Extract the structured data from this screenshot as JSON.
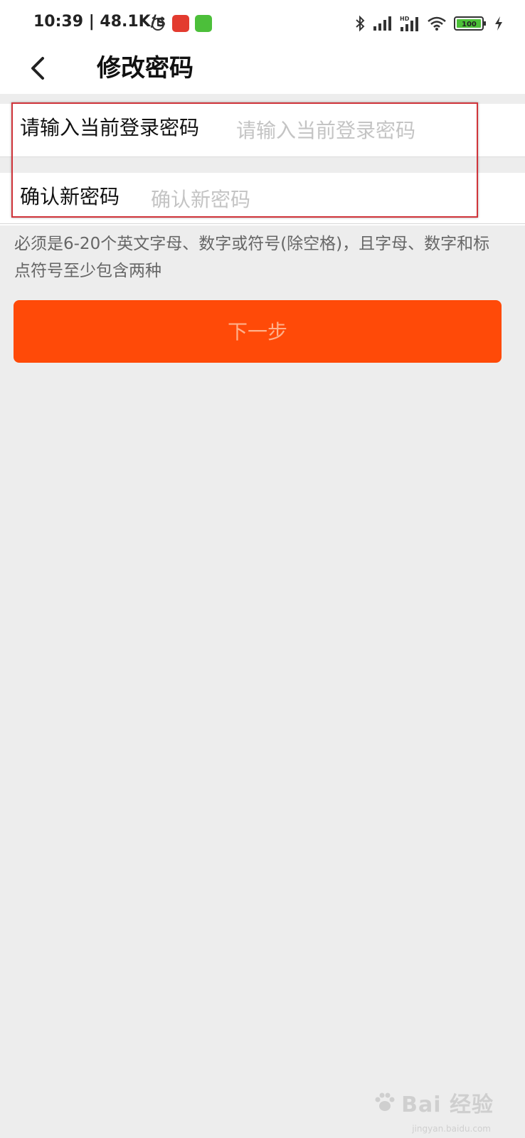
{
  "status_bar": {
    "time_speed": "10:39 | 48.1K/s",
    "battery": "100",
    "network_hd": "HD"
  },
  "nav": {
    "title": "修改密码"
  },
  "form": {
    "current_password_label": "请输入当前登录密码",
    "current_password_placeholder": "请输入当前登录密码",
    "confirm_password_label": "确认新密码",
    "confirm_password_placeholder": "确认新密码"
  },
  "hint": "必须是6-20个英文字母、数字或符号(除空格)，且字母、数字和标点符号至少包含两种",
  "next_button": "下一步",
  "watermark": {
    "brand": "Bai 经验",
    "url": "jingyan.baidu.com"
  },
  "colors": {
    "accent": "#ff4a08",
    "highlight_border": "#d0343a",
    "background": "#ededed"
  },
  "icons": [
    "alarm-icon",
    "netease-music-icon",
    "green-app-icon",
    "bluetooth-icon",
    "signal-icon",
    "wifi-icon",
    "battery-icon",
    "charging-icon",
    "back-arrow-icon"
  ]
}
